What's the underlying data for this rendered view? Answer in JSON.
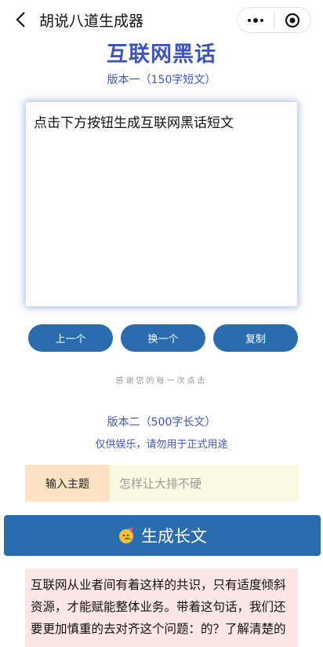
{
  "nav": {
    "title": "胡说八道生成器",
    "back_icon": "chevron-left-icon",
    "more_icon": "more-dots-icon",
    "close_icon": "target-close-icon"
  },
  "main_title": "互联网黑话",
  "version1": {
    "subtitle": "版本一（150字短文）",
    "text": "点击下方按钮生成互联网黑话短文",
    "buttons": {
      "prev": "上一个",
      "next": "换一个",
      "copy": "复制"
    }
  },
  "thanks": "感谢您的每一次点击",
  "version2": {
    "title": "版本二（500字长文）",
    "note": "仅供娱乐，请勿用于正式用途",
    "topic_label": "输入主题",
    "topic_placeholder": "怎样让大排不硬",
    "generate_label": "生成长文",
    "generate_icon": "party-face-icon",
    "article": "互联网从业者间有着这样的共识，只有适度倾斜资源，才能赋能整体业务。带着这句话，我们还要更加慎重的去对齐这个问题：的？了解清楚的"
  },
  "colors": {
    "accent": "#3f56b5",
    "button": "#2a6cae",
    "label_bg": "#fde3c3",
    "input_bg": "#fafae3",
    "article_bg": "#fde6e6"
  }
}
